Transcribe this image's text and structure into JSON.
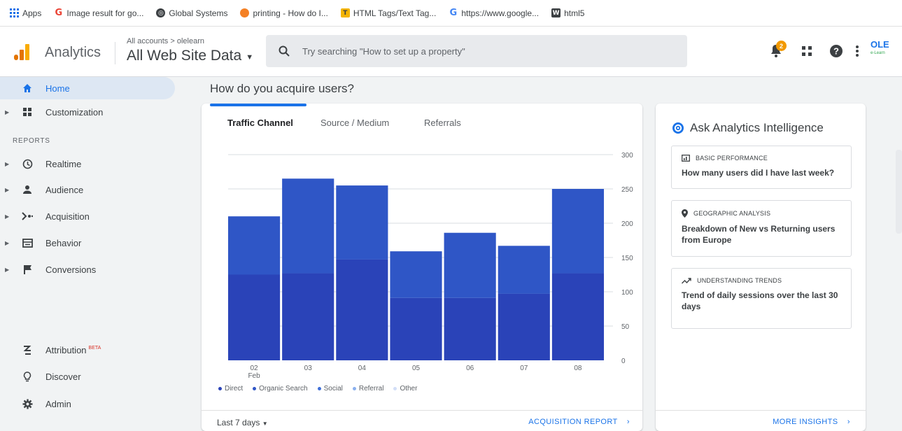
{
  "bookmarks": [
    {
      "label": "Apps",
      "icon": "apps-grid-icon",
      "color": "#1a73e8"
    },
    {
      "label": "Image result for go...",
      "icon": "google-icon",
      "color": "#ea4335"
    },
    {
      "label": "Global Systems",
      "icon": "globe-icon",
      "color": "#5f6368"
    },
    {
      "label": "printing - How do I...",
      "icon": "stackoverflow-icon",
      "color": "#f48024"
    },
    {
      "label": "HTML Tags/Text Tag...",
      "icon": "t-favicon-icon",
      "color": "#f4b400"
    },
    {
      "label": "https://www.google...",
      "icon": "google-icon",
      "color": "#4285f4"
    },
    {
      "label": "html5",
      "icon": "w-favicon-icon",
      "color": "#3c4043"
    }
  ],
  "header": {
    "app_name": "Analytics",
    "breadcrumb": "All accounts > olelearn",
    "property": "All Web Site Data",
    "search_placeholder": "Try searching \"How to set up a property\"",
    "notification_count": "2",
    "account_logo": "OLE",
    "account_logo_sub": "e-Learn"
  },
  "sidebar": {
    "items_top": [
      {
        "label": "Home",
        "icon": "home-icon",
        "active": true
      },
      {
        "label": "Customization",
        "icon": "dashboard-icon",
        "active": false
      }
    ],
    "section_label": "REPORTS",
    "reports": [
      {
        "label": "Realtime",
        "icon": "clock-icon"
      },
      {
        "label": "Audience",
        "icon": "person-icon"
      },
      {
        "label": "Acquisition",
        "icon": "acquisition-icon"
      },
      {
        "label": "Behavior",
        "icon": "behavior-icon"
      },
      {
        "label": "Conversions",
        "icon": "flag-icon"
      }
    ],
    "bottom": [
      {
        "label": "Attribution",
        "icon": "attribution-icon",
        "badge": "BETA"
      },
      {
        "label": "Discover",
        "icon": "lightbulb-icon"
      },
      {
        "label": "Admin",
        "icon": "gear-icon"
      }
    ]
  },
  "main": {
    "title": "How do you acquire users?",
    "tabs": [
      "Traffic Channel",
      "Source / Medium",
      "Referrals"
    ],
    "selected_tab": 0,
    "date_range": "Last 7 days",
    "report_link": "ACQUISITION REPORT"
  },
  "chart_data": {
    "type": "bar",
    "categories": [
      "02 Feb",
      "03",
      "04",
      "05",
      "06",
      "07",
      "08"
    ],
    "category_labels": [
      [
        "02",
        "Feb"
      ],
      [
        "03"
      ],
      [
        "04"
      ],
      [
        "05"
      ],
      [
        "06"
      ],
      [
        "07"
      ],
      [
        "08"
      ]
    ],
    "series": [
      {
        "name": "Direct",
        "values": [
          125,
          127,
          147,
          91,
          91,
          97,
          127
        ],
        "color": "#2a43b8"
      },
      {
        "name": "Organic Search",
        "values": [
          85,
          138,
          108,
          68,
          95,
          70,
          123
        ],
        "color": "#2f56c6"
      },
      {
        "name": "Social",
        "values": [
          0,
          0,
          0,
          0,
          0,
          0,
          0
        ],
        "color": "#3f6fd8"
      },
      {
        "name": "Referral",
        "values": [
          0,
          0,
          0,
          0,
          0,
          0,
          0
        ],
        "color": "#8ab0ee"
      },
      {
        "name": "Other",
        "values": [
          0,
          0,
          0,
          0,
          0,
          0,
          0
        ],
        "color": "#d2def7"
      }
    ],
    "legend_colors": [
      "#2a43b8",
      "#2f56c6",
      "#3f6fd8",
      "#8ab0ee",
      "#d2def7"
    ],
    "ylim": [
      0,
      300
    ],
    "yticks": [
      0,
      50,
      100,
      150,
      200,
      250,
      300
    ],
    "grid": true,
    "legend": "bottom-left"
  },
  "insights": {
    "title": "Ask Analytics Intelligence",
    "cards": [
      {
        "category": "BASIC PERFORMANCE",
        "question": "How many users did I have last week?",
        "icon": "performance-icon"
      },
      {
        "category": "GEOGRAPHIC ANALYSIS",
        "question": "Breakdown of New vs Returning users from Europe",
        "icon": "location-pin-icon"
      },
      {
        "category": "UNDERSTANDING TRENDS",
        "question": "Trend of daily sessions over the last 30 days",
        "icon": "trend-icon"
      }
    ],
    "more_link": "MORE INSIGHTS"
  }
}
